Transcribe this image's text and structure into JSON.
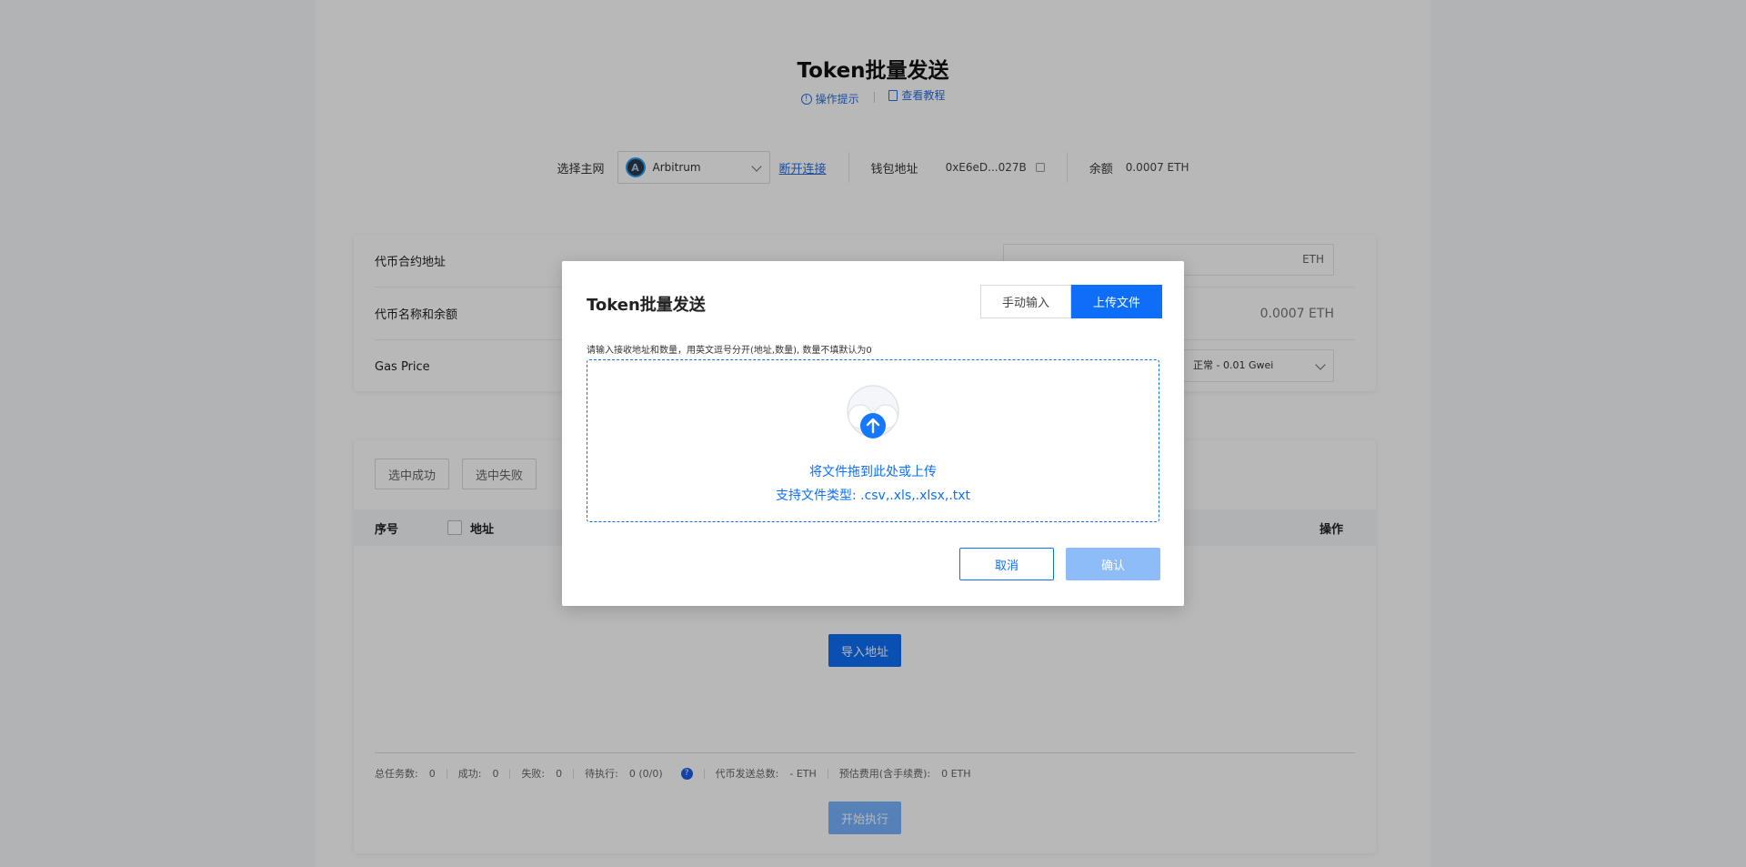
{
  "header": {
    "title": "Token批量发送",
    "tips_label": "操作提示",
    "tutorial_label": "查看教程"
  },
  "network_bar": {
    "select_label": "选择主网",
    "network_value": "Arbitrum",
    "network_icon": "A",
    "disconnect_label": "断开连接",
    "wallet_label": "钱包地址",
    "wallet_address": "0xE6eD...027B",
    "balance_label": "余额",
    "balance_value": "0.0007 ETH"
  },
  "settings_card": {
    "contract_label": "代币合约地址",
    "contract_suffix": "ETH",
    "name_balance_label": "代币名称和余额",
    "balance_value": "0.0007 ETH",
    "gas_label": "Gas Price",
    "gas_value": "正常 - 0.01 Gwei"
  },
  "table_card": {
    "filter_success": "选中成功",
    "filter_fail": "选中失败",
    "col_index": "序号",
    "col_address": "地址",
    "col_action": "操作",
    "import_label": "导入地址",
    "start_label": "开始执行",
    "stats": {
      "total_label": "总任务数:",
      "total_value": "0",
      "success_label": "成功:",
      "success_value": "0",
      "fail_label": "失败:",
      "fail_value": "0",
      "pending_label": "待执行:",
      "pending_value": "0 (0/0)",
      "sent_label": "代币发送总数:",
      "sent_value": "- ETH",
      "fee_label": "预估费用(含手续费):",
      "fee_value": "0 ETH",
      "help_icon": "?"
    }
  },
  "modal": {
    "title": "Token批量发送",
    "tab_manual": "手动输入",
    "tab_upload": "上传文件",
    "hint": "请输入接收地址和数量，用英文逗号分开(地址,数量), 数量不填默认为0",
    "drop_text": "将文件拖到此处或上传",
    "drop_types": "支持文件类型: .csv,.xls,.xlsx,.txt",
    "cancel_label": "取消",
    "confirm_label": "确认"
  },
  "colors": {
    "accent": "#0e6ef7",
    "link": "#2a6edb",
    "overlay": "rgba(0,0,0,0.28)"
  }
}
